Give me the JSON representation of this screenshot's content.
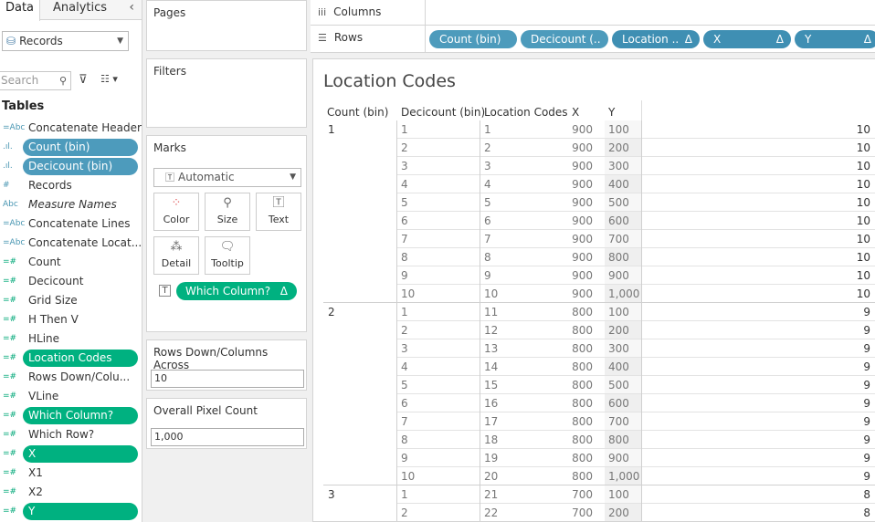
{
  "left_pane": {
    "tab_data": "Data",
    "tab_analytics": "Analytics",
    "collapse_glyph": "‹",
    "datasource": "Records",
    "search_placeholder": "Search",
    "tables_heading": "Tables",
    "fields": [
      {
        "type": "=Abc",
        "label": "Concatenate Header",
        "style": "dim"
      },
      {
        "type": ".ıl.",
        "label": "Count (bin)",
        "style": "pill-blue"
      },
      {
        "type": ".ıl.",
        "label": "Decicount (bin)",
        "style": "pill-blue"
      },
      {
        "type": "#",
        "label": "Records",
        "style": "dim"
      },
      {
        "type": "Abc",
        "label": "Measure Names",
        "style": "dim",
        "italic": true
      },
      {
        "type": "=Abc",
        "label": "Concatenate Lines",
        "style": "dim"
      },
      {
        "type": "=Abc",
        "label": "Concatenate Locat...",
        "style": "dim"
      },
      {
        "type": "=#",
        "label": "Count",
        "style": "meas"
      },
      {
        "type": "=#",
        "label": "Decicount",
        "style": "meas"
      },
      {
        "type": "=#",
        "label": "Grid Size",
        "style": "meas"
      },
      {
        "type": "=#",
        "label": "H Then V",
        "style": "meas"
      },
      {
        "type": "=#",
        "label": "HLine",
        "style": "meas"
      },
      {
        "type": "=#",
        "label": "Location Codes",
        "style": "pill-green"
      },
      {
        "type": "=#",
        "label": "Rows Down/Colu...",
        "style": "meas"
      },
      {
        "type": "=#",
        "label": "VLine",
        "style": "meas"
      },
      {
        "type": "=#",
        "label": "Which Column?",
        "style": "pill-green"
      },
      {
        "type": "=#",
        "label": "Which Row?",
        "style": "meas"
      },
      {
        "type": "=#",
        "label": "X",
        "style": "pill-green"
      },
      {
        "type": "=#",
        "label": "X1",
        "style": "meas"
      },
      {
        "type": "=#",
        "label": "X2",
        "style": "meas"
      },
      {
        "type": "=#",
        "label": "Y",
        "style": "pill-green"
      }
    ]
  },
  "cards": {
    "pages": "Pages",
    "filters": "Filters",
    "marks": "Marks",
    "mark_type": "Automatic",
    "buttons": [
      "Color",
      "Size",
      "Text",
      "Detail",
      "Tooltip"
    ],
    "text_pill": "Which Column?",
    "rows_down_title": "Rows Down/Columns Across",
    "rows_down_value": "10",
    "pixel_title": "Overall Pixel Count",
    "pixel_value": "1,000"
  },
  "shelves": {
    "columns_label": "Columns",
    "rows_label": "Rows",
    "row_pills": [
      "Count (bin)",
      "Decicount (..",
      "Location ..",
      "X",
      "Y"
    ],
    "delta": "Δ"
  },
  "view": {
    "title": "Location Codes",
    "headers": [
      "Count (bin)",
      "Decicount (bin)",
      "Location Codes",
      "X",
      "Y"
    ],
    "rows": [
      [
        "1",
        "1",
        "1",
        "900",
        "100",
        "10"
      ],
      [
        "",
        "2",
        "2",
        "900",
        "200",
        "10"
      ],
      [
        "",
        "3",
        "3",
        "900",
        "300",
        "10"
      ],
      [
        "",
        "4",
        "4",
        "900",
        "400",
        "10"
      ],
      [
        "",
        "5",
        "5",
        "900",
        "500",
        "10"
      ],
      [
        "",
        "6",
        "6",
        "900",
        "600",
        "10"
      ],
      [
        "",
        "7",
        "7",
        "900",
        "700",
        "10"
      ],
      [
        "",
        "8",
        "8",
        "900",
        "800",
        "10"
      ],
      [
        "",
        "9",
        "9",
        "900",
        "900",
        "10"
      ],
      [
        "",
        "10",
        "10",
        "900",
        "1,000",
        "10"
      ],
      [
        "2",
        "1",
        "11",
        "800",
        "100",
        "9"
      ],
      [
        "",
        "2",
        "12",
        "800",
        "200",
        "9"
      ],
      [
        "",
        "3",
        "13",
        "800",
        "300",
        "9"
      ],
      [
        "",
        "4",
        "14",
        "800",
        "400",
        "9"
      ],
      [
        "",
        "5",
        "15",
        "800",
        "500",
        "9"
      ],
      [
        "",
        "6",
        "16",
        "800",
        "600",
        "9"
      ],
      [
        "",
        "7",
        "17",
        "800",
        "700",
        "9"
      ],
      [
        "",
        "8",
        "18",
        "800",
        "800",
        "9"
      ],
      [
        "",
        "9",
        "19",
        "800",
        "900",
        "9"
      ],
      [
        "",
        "10",
        "20",
        "800",
        "1,000",
        "9"
      ],
      [
        "3",
        "1",
        "21",
        "700",
        "100",
        "8"
      ],
      [
        "",
        "2",
        "22",
        "700",
        "200",
        "8"
      ]
    ]
  },
  "colors": {
    "dim_pill": "#4d9bbc",
    "measure_pill": "#00b180"
  }
}
